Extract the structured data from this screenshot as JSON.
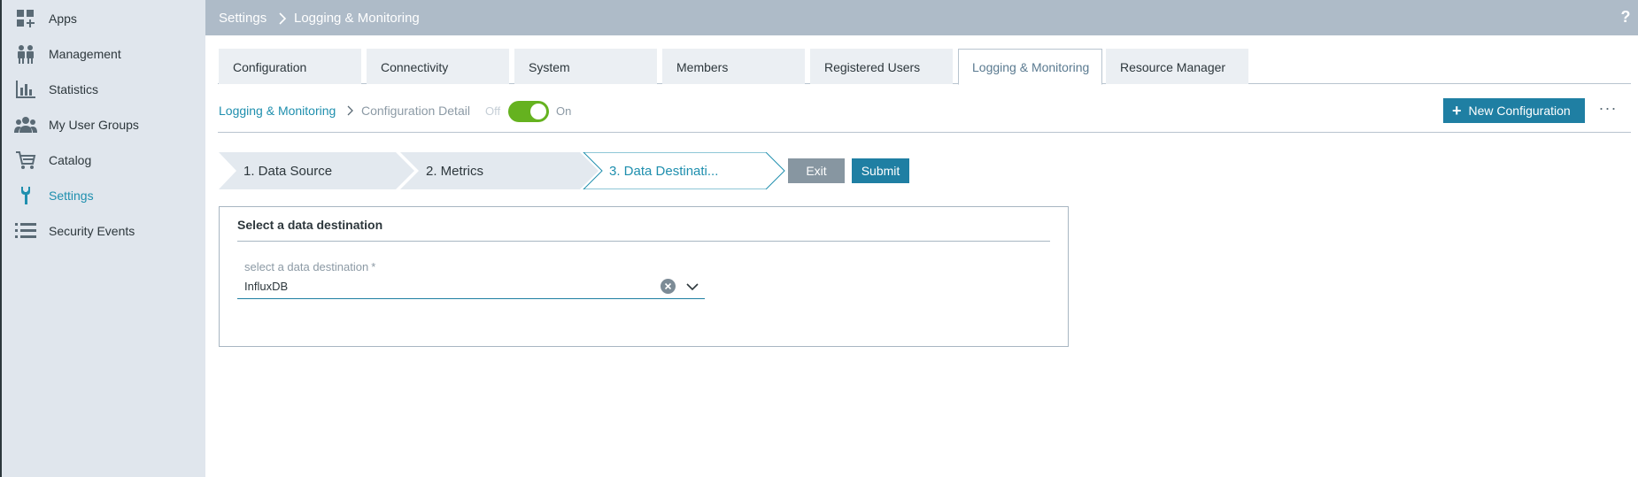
{
  "topbar": {
    "crumb_root": "Settings",
    "crumb_current": "Logging & Monitoring",
    "help": "?"
  },
  "sidebar": {
    "items": [
      {
        "label": "Apps",
        "icon": "apps-grid-icon"
      },
      {
        "label": "Management",
        "icon": "people-management-icon"
      },
      {
        "label": "Statistics",
        "icon": "bar-chart-icon"
      },
      {
        "label": "My User Groups",
        "icon": "user-group-icon"
      },
      {
        "label": "Catalog",
        "icon": "cart-icon"
      },
      {
        "label": "Settings",
        "icon": "wrench-icon",
        "active": true
      },
      {
        "label": "Security Events",
        "icon": "list-icon"
      }
    ]
  },
  "tabs": [
    {
      "label": "Configuration"
    },
    {
      "label": "Connectivity"
    },
    {
      "label": "System"
    },
    {
      "label": "Members"
    },
    {
      "label": "Registered Users"
    },
    {
      "label": "Logging & Monitoring",
      "active": true
    },
    {
      "label": "Resource Manager"
    }
  ],
  "subheader": {
    "link": "Logging & Monitoring",
    "current": "Configuration Detail",
    "toggle_off": "Off",
    "toggle_on": "On",
    "toggle_state": true,
    "new_config_label": "New Configuration",
    "more_label": "···"
  },
  "wizard": {
    "steps": [
      {
        "label": "1. Data Source"
      },
      {
        "label": "2. Metrics"
      },
      {
        "label": "3. Data Destinati...",
        "active": true
      }
    ],
    "exit_label": "Exit",
    "submit_label": "Submit"
  },
  "panel": {
    "title": "Select a data destination",
    "field_label": "select a data destination",
    "required_mark": "*",
    "field_value": "InfluxDB"
  },
  "colors": {
    "accent": "#1f7fa3",
    "link": "#1f8fae",
    "toggle_on": "#65b21f",
    "topbar": "#aebbc8",
    "sidebar": "#e0e6ed"
  }
}
